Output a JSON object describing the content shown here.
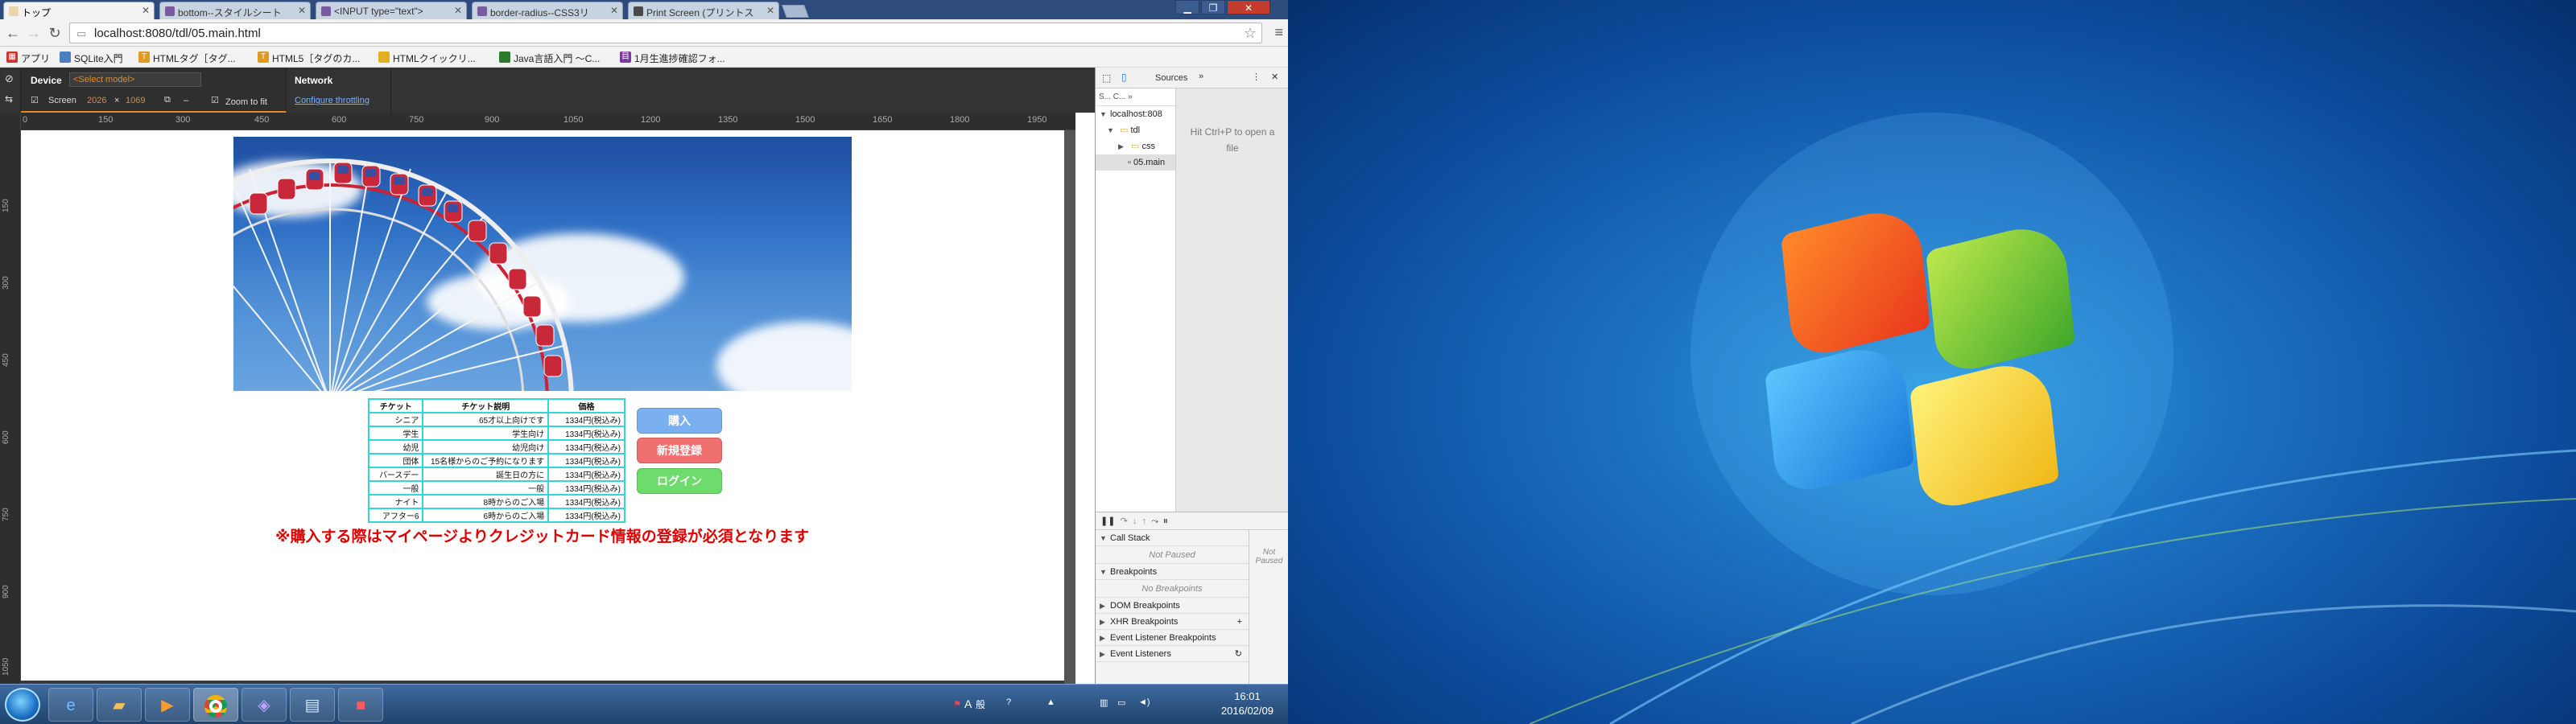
{
  "browser": {
    "tabs": [
      {
        "title": "トップ",
        "color": "#e8d8a8"
      },
      {
        "title": "bottom--スタイルシート",
        "color": "#7a5aa0"
      },
      {
        "title": "<INPUT type=\"text\">",
        "color": "#7a5aa0"
      },
      {
        "title": "border-radius--CSS3リ",
        "color": "#7a5aa0"
      },
      {
        "title": "Print Screen (プリントス",
        "color": "#4a4a4a"
      }
    ],
    "url": "localhost:8080/tdl/05.main.html",
    "bookmarks": [
      {
        "label": "アプリ",
        "color": "#c33"
      },
      {
        "label": "SQLite入門",
        "color": "#4a7fc0"
      },
      {
        "label": "HTMLタグ［タグ...",
        "color": "#e09a20"
      },
      {
        "label": "HTML5［タグのカ...",
        "color": "#e09a20"
      },
      {
        "label": "HTMLクイックリ...",
        "color": "#e0b020"
      },
      {
        "label": "Java言語入門 ～C...",
        "color": "#2a7a2a"
      },
      {
        "label": "1月生進捗確認フォ...",
        "color": "#7a3aa0"
      }
    ]
  },
  "device_toolbar": {
    "device_label": "Device",
    "device_select": "<Select model>",
    "screen_label": "Screen",
    "width": "2026",
    "height": "1069",
    "zoom_label": "Zoom to fit",
    "network_label": "Network",
    "throttle_link": "Configure throttling",
    "ruler_ticks": [
      "0",
      "150",
      "300",
      "450",
      "600",
      "750",
      "900",
      "1050",
      "1200",
      "1350",
      "1500",
      "1650",
      "1800",
      "1950"
    ],
    "ruler_left": [
      "150",
      "300",
      "450",
      "600",
      "750",
      "900",
      "1050"
    ]
  },
  "page": {
    "table_headers": [
      "チケット",
      "チケット説明",
      "価格"
    ],
    "table_rows": [
      [
        "シニア",
        "65才以上向けです",
        "1334円(税込み)"
      ],
      [
        "学生",
        "学生向け",
        "1334円(税込み)"
      ],
      [
        "幼児",
        "幼児向け",
        "1334円(税込み)"
      ],
      [
        "団体",
        "15名様からのご予約になります",
        "1334円(税込み)"
      ],
      [
        "バースデー",
        "誕生日の方に",
        "1334円(税込み)"
      ],
      [
        "一般",
        "一般",
        "1334円(税込み)"
      ],
      [
        "ナイト",
        "8時からのご入場",
        "1334円(税込み)"
      ],
      [
        "アフター6",
        "6時からのご入場",
        "1334円(税込み)"
      ]
    ],
    "buttons": {
      "purchase": "購入",
      "register": "新規登録",
      "login": "ログイン"
    },
    "notice": "※購入する際はマイページよりクレジットカード情報の登録が必須となります",
    "colors": {
      "purchase": "#7ab0ef",
      "register": "#f07070",
      "login": "#6ddc6d"
    }
  },
  "devtools": {
    "sources_tab": "Sources",
    "tree": [
      "localhost:808",
      "tdl",
      "css",
      "05.main"
    ],
    "editor_hint_1": "Hit Ctrl+P to open a",
    "editor_hint_2": "file",
    "call_stack": "Call Stack",
    "not_paused": "Not Paused",
    "breakpoints": "Breakpoints",
    "no_breakpoints": "No Breakpoints",
    "dom_breakpoints": "DOM Breakpoints",
    "xhr_breakpoints": "XHR Breakpoints",
    "event_listener_breakpoints": "Event Listener Breakpoints",
    "event_listeners": "Event Listeners",
    "side_not_paused": "Not Paused"
  },
  "taskbar": {
    "time": "16:01",
    "date": "2016/02/09",
    "ime_a": "A",
    "ime_label": "般"
  }
}
